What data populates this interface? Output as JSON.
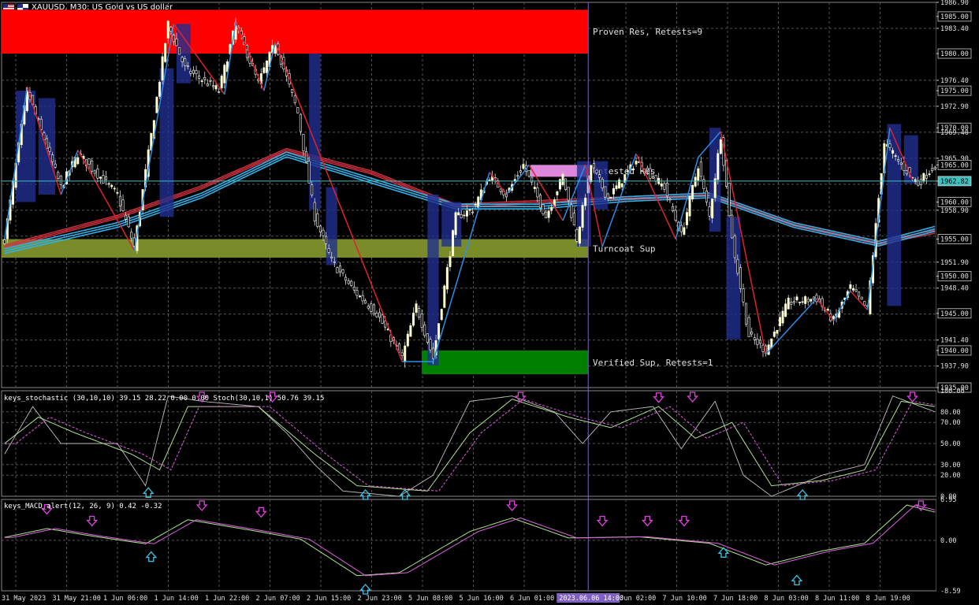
{
  "header": {
    "symbol_title": "XAUUSD, M30:  US Gold vs US dollar",
    "flag_icons": [
      "flag-us-icon",
      "flag-eu-icon"
    ]
  },
  "colors": {
    "background": "#000000",
    "bull_candle": "#ffffd0",
    "bear_candle": "#ffffff",
    "resistance_zone": "#ff0000",
    "turncoat_zone": "#7a8c2a",
    "support_zone": "#008000",
    "weak_zone": "#dd88dd",
    "zigzag_down": "#e02030",
    "zigzag_up": "#2a8fe8",
    "ma_red": "#d03040",
    "ma_blue": "#30b0e8",
    "current_price_line": "#40c0c0",
    "vertical_marker": "#8060c0",
    "stoch_main": "#c0c0c0",
    "stoch_signal": "#b0e090",
    "macd_signal": "#e060e0",
    "arrow_down": "#e040e0",
    "arrow_up": "#40c0e0",
    "grid": "#555555"
  },
  "zones": [
    {
      "label": "Proven Res, Retests=9",
      "top": 1985.9,
      "bottom": 1980.0
    },
    {
      "label": "Untested Res",
      "top": 1965.0,
      "bottom": 1963.4
    },
    {
      "label": "Turncoat Sup",
      "top": 1955.0,
      "bottom": 1952.5
    },
    {
      "label": "Verified Sup, Retests=1",
      "top": 1940.0,
      "bottom": 1936.8
    }
  ],
  "current_price": "1962.82",
  "price_axis_ticks": [
    "1986.90",
    "1985.00",
    "1983.40",
    "1980.00",
    "1976.40",
    "1975.00",
    "1972.90",
    "1970.00",
    "1969.40",
    "1965.90",
    "1965.00",
    "1962.82",
    "1960.00",
    "1958.90",
    "1955.00",
    "1951.90",
    "1950.00",
    "1948.40",
    "1945.00",
    "1941.40",
    "1940.00",
    "1937.90",
    "1935.00"
  ],
  "time_axis_labels": [
    "31 May 2023",
    "31 May 21:00",
    "1 Jun 06:00",
    "1 Jun 14:00",
    "1 Jun 22:00",
    "2 Jun 07:00",
    "2 Jun 15:00",
    "2 Jun 23:00",
    "5 Jun 08:00",
    "5 Jun 16:00",
    "6 Jun 01:00",
    "6 Jun 17:00",
    "7 Jun 02:00",
    "7 Jun 10:00",
    "7 Jun 18:00",
    "8 Jun 03:00",
    "8 Jun 11:00",
    "8 Jun 19:00"
  ],
  "crosshair_time_label": "2023.06.06 14:00",
  "stoch_panel": {
    "label": "keys_stochastic (30,10,10) 39.15 28.22 0.00 0.00 Stoch(30,10,1) 50.76 39.15",
    "ticks": [
      "100.00",
      "80.00",
      "70.00",
      "50.00",
      "30.00",
      "20.00",
      "0.00"
    ]
  },
  "macd_panel": {
    "label": "keys_MACD_alert(12, 26, 9) 0.42 -0.32",
    "ticks": [
      "6.95",
      "0.00",
      "-8.59"
    ]
  },
  "chart_data": {
    "type": "candlestick",
    "title": "XAUUSD, M30:  US Gold vs US dollar",
    "ylim": [
      1935.0,
      1986.9
    ],
    "grid": true,
    "price_path_anchors": [
      {
        "i": 0,
        "p": 1955.0
      },
      {
        "i": 8,
        "p": 1975.0
      },
      {
        "i": 20,
        "p": 1962.0
      },
      {
        "i": 26,
        "p": 1966.5
      },
      {
        "i": 40,
        "p": 1961.0
      },
      {
        "i": 46,
        "p": 1954.0
      },
      {
        "i": 58,
        "p": 1984.0
      },
      {
        "i": 64,
        "p": 1978.0
      },
      {
        "i": 76,
        "p": 1975.0
      },
      {
        "i": 82,
        "p": 1984.0
      },
      {
        "i": 90,
        "p": 1976.0
      },
      {
        "i": 96,
        "p": 1981.5
      },
      {
        "i": 104,
        "p": 1972.0
      },
      {
        "i": 110,
        "p": 1958.0
      },
      {
        "i": 116,
        "p": 1952.0
      },
      {
        "i": 124,
        "p": 1948.0
      },
      {
        "i": 132,
        "p": 1945.0
      },
      {
        "i": 141,
        "p": 1939.0
      },
      {
        "i": 146,
        "p": 1946.0
      },
      {
        "i": 152,
        "p": 1939.0
      },
      {
        "i": 160,
        "p": 1958.0
      },
      {
        "i": 166,
        "p": 1959.0
      },
      {
        "i": 172,
        "p": 1963.5
      },
      {
        "i": 178,
        "p": 1961.0
      },
      {
        "i": 184,
        "p": 1965.0
      },
      {
        "i": 192,
        "p": 1958.0
      },
      {
        "i": 198,
        "p": 1963.5
      },
      {
        "i": 203,
        "p": 1955.0
      },
      {
        "i": 208,
        "p": 1965.0
      },
      {
        "i": 214,
        "p": 1960.5
      },
      {
        "i": 224,
        "p": 1965.5
      },
      {
        "i": 234,
        "p": 1962.0
      },
      {
        "i": 240,
        "p": 1955.5
      },
      {
        "i": 246,
        "p": 1965.0
      },
      {
        "i": 250,
        "p": 1958.0
      },
      {
        "i": 254,
        "p": 1969.0
      },
      {
        "i": 258,
        "p": 1955.0
      },
      {
        "i": 264,
        "p": 1942.0
      },
      {
        "i": 270,
        "p": 1940.0
      },
      {
        "i": 278,
        "p": 1946.5
      },
      {
        "i": 288,
        "p": 1947.0
      },
      {
        "i": 294,
        "p": 1944.0
      },
      {
        "i": 300,
        "p": 1948.5
      },
      {
        "i": 306,
        "p": 1945.5
      },
      {
        "i": 312,
        "p": 1968.0
      },
      {
        "i": 318,
        "p": 1965.0
      },
      {
        "i": 324,
        "p": 1962.5
      },
      {
        "i": 330,
        "p": 1965.0
      }
    ],
    "zigzag": [
      {
        "i": 0,
        "p": 1955.0
      },
      {
        "i": 8,
        "p": 1975.5
      },
      {
        "i": 20,
        "p": 1961.0
      },
      {
        "i": 26,
        "p": 1967.0
      },
      {
        "i": 46,
        "p": 1953.5
      },
      {
        "i": 60,
        "p": 1984.0
      },
      {
        "i": 78,
        "p": 1974.5
      },
      {
        "i": 82,
        "p": 1984.2
      },
      {
        "i": 92,
        "p": 1975.0
      },
      {
        "i": 96,
        "p": 1981.5
      },
      {
        "i": 141,
        "p": 1938.5
      },
      {
        "i": 152,
        "p": 1938.5
      },
      {
        "i": 172,
        "p": 1964.0
      },
      {
        "i": 178,
        "p": 1961.0
      },
      {
        "i": 186,
        "p": 1965.0
      },
      {
        "i": 198,
        "p": 1957.5
      },
      {
        "i": 206,
        "p": 1965.0
      },
      {
        "i": 212,
        "p": 1954.0
      },
      {
        "i": 224,
        "p": 1966.5
      },
      {
        "i": 238,
        "p": 1955.0
      },
      {
        "i": 246,
        "p": 1966.0
      },
      {
        "i": 254,
        "p": 1969.5
      },
      {
        "i": 270,
        "p": 1939.5
      },
      {
        "i": 288,
        "p": 1947.0
      },
      {
        "i": 294,
        "p": 1944.0
      },
      {
        "i": 300,
        "p": 1948.0
      },
      {
        "i": 306,
        "p": 1945.5
      },
      {
        "i": 314,
        "p": 1970.0
      },
      {
        "i": 322,
        "p": 1963.0
      }
    ],
    "ma_red_path": [
      {
        "i": 0,
        "p": 1954.0
      },
      {
        "i": 40,
        "p": 1958.0
      },
      {
        "i": 70,
        "p": 1962.0
      },
      {
        "i": 100,
        "p": 1967.0
      },
      {
        "i": 130,
        "p": 1964.0
      },
      {
        "i": 160,
        "p": 1959.5
      },
      {
        "i": 190,
        "p": 1960.0
      },
      {
        "i": 220,
        "p": 1960.5
      },
      {
        "i": 250,
        "p": 1961.0
      },
      {
        "i": 280,
        "p": 1957.0
      },
      {
        "i": 310,
        "p": 1954.5
      },
      {
        "i": 330,
        "p": 1956.0
      }
    ],
    "ma_blue_path": [
      {
        "i": 0,
        "p": 1953.5
      },
      {
        "i": 40,
        "p": 1957.0
      },
      {
        "i": 70,
        "p": 1961.0
      },
      {
        "i": 100,
        "p": 1966.5
      },
      {
        "i": 130,
        "p": 1963.0
      },
      {
        "i": 160,
        "p": 1959.5
      },
      {
        "i": 190,
        "p": 1959.5
      },
      {
        "i": 220,
        "p": 1960.5
      },
      {
        "i": 250,
        "p": 1961.0
      },
      {
        "i": 280,
        "p": 1957.0
      },
      {
        "i": 310,
        "p": 1954.5
      },
      {
        "i": 330,
        "p": 1956.5
      }
    ],
    "stoch_main_path": [
      {
        "i": 0,
        "v": 40
      },
      {
        "i": 10,
        "v": 85
      },
      {
        "i": 20,
        "v": 50
      },
      {
        "i": 40,
        "v": 50
      },
      {
        "i": 50,
        "v": 10
      },
      {
        "i": 58,
        "v": 95
      },
      {
        "i": 70,
        "v": 90
      },
      {
        "i": 90,
        "v": 85
      },
      {
        "i": 100,
        "v": 60
      },
      {
        "i": 110,
        "v": 30
      },
      {
        "i": 120,
        "v": 5
      },
      {
        "i": 140,
        "v": 0
      },
      {
        "i": 152,
        "v": 20
      },
      {
        "i": 165,
        "v": 90
      },
      {
        "i": 180,
        "v": 95
      },
      {
        "i": 195,
        "v": 80
      },
      {
        "i": 205,
        "v": 50
      },
      {
        "i": 215,
        "v": 80
      },
      {
        "i": 230,
        "v": 85
      },
      {
        "i": 240,
        "v": 45
      },
      {
        "i": 252,
        "v": 90
      },
      {
        "i": 262,
        "v": 20
      },
      {
        "i": 272,
        "v": 0
      },
      {
        "i": 290,
        "v": 20
      },
      {
        "i": 305,
        "v": 30
      },
      {
        "i": 315,
        "v": 95
      },
      {
        "i": 330,
        "v": 80
      }
    ],
    "stoch_signal_path": [
      {
        "i": 0,
        "v": 50
      },
      {
        "i": 12,
        "v": 75
      },
      {
        "i": 25,
        "v": 60
      },
      {
        "i": 45,
        "v": 40
      },
      {
        "i": 55,
        "v": 25
      },
      {
        "i": 65,
        "v": 85
      },
      {
        "i": 90,
        "v": 85
      },
      {
        "i": 110,
        "v": 40
      },
      {
        "i": 125,
        "v": 10
      },
      {
        "i": 150,
        "v": 5
      },
      {
        "i": 165,
        "v": 60
      },
      {
        "i": 180,
        "v": 92
      },
      {
        "i": 200,
        "v": 75
      },
      {
        "i": 215,
        "v": 65
      },
      {
        "i": 232,
        "v": 85
      },
      {
        "i": 245,
        "v": 55
      },
      {
        "i": 258,
        "v": 70
      },
      {
        "i": 272,
        "v": 10
      },
      {
        "i": 290,
        "v": 15
      },
      {
        "i": 305,
        "v": 25
      },
      {
        "i": 318,
        "v": 90
      },
      {
        "i": 330,
        "v": 85
      }
    ],
    "macd_path": [
      {
        "i": 0,
        "v": 0.5
      },
      {
        "i": 15,
        "v": 2.0
      },
      {
        "i": 30,
        "v": 0.8
      },
      {
        "i": 50,
        "v": -0.6
      },
      {
        "i": 65,
        "v": 3.5
      },
      {
        "i": 90,
        "v": 1.5
      },
      {
        "i": 105,
        "v": 0.2
      },
      {
        "i": 125,
        "v": -6.0
      },
      {
        "i": 140,
        "v": -5.5
      },
      {
        "i": 165,
        "v": 1.5
      },
      {
        "i": 180,
        "v": 3.8
      },
      {
        "i": 200,
        "v": 0.4
      },
      {
        "i": 225,
        "v": 0.6
      },
      {
        "i": 250,
        "v": -0.5
      },
      {
        "i": 270,
        "v": -4.2
      },
      {
        "i": 290,
        "v": -1.8
      },
      {
        "i": 305,
        "v": -0.5
      },
      {
        "i": 320,
        "v": 6.0
      },
      {
        "i": 330,
        "v": 4.8
      }
    ],
    "stoch_arrows": [
      {
        "i": 70,
        "dir": "down",
        "v": 98
      },
      {
        "i": 95,
        "dir": "down",
        "v": 98
      },
      {
        "i": 51,
        "dir": "up",
        "v": 5
      },
      {
        "i": 128,
        "dir": "up",
        "v": -10
      },
      {
        "i": 142,
        "dir": "up",
        "v": -10
      },
      {
        "i": 183,
        "dir": "down",
        "v": 100
      },
      {
        "i": 232,
        "dir": "down",
        "v": 92
      },
      {
        "i": 244,
        "dir": "down",
        "v": 100
      },
      {
        "i": 283,
        "dir": "up",
        "v": -8
      },
      {
        "i": 322,
        "dir": "down",
        "v": 100
      }
    ],
    "macd_arrows": [
      {
        "i": 15,
        "dir": "down",
        "v": 5.0
      },
      {
        "i": 31,
        "dir": "down",
        "v": 3.0
      },
      {
        "i": 52,
        "dir": "up",
        "v": -2.5
      },
      {
        "i": 70,
        "dir": "down",
        "v": 6.0
      },
      {
        "i": 91,
        "dir": "down",
        "v": 4.5
      },
      {
        "i": 128,
        "dir": "up",
        "v": -8.5
      },
      {
        "i": 180,
        "dir": "down",
        "v": 6.5
      },
      {
        "i": 212,
        "dir": "down",
        "v": 3.0
      },
      {
        "i": 228,
        "dir": "down",
        "v": 3.0
      },
      {
        "i": 241,
        "dir": "down",
        "v": 3.0
      },
      {
        "i": 255,
        "dir": "up",
        "v": -1.8
      },
      {
        "i": 281,
        "dir": "up",
        "v": -6.5
      },
      {
        "i": 325,
        "dir": "down",
        "v": 7.0
      }
    ],
    "vertical_marker_index": 207,
    "bar_count": 331
  }
}
